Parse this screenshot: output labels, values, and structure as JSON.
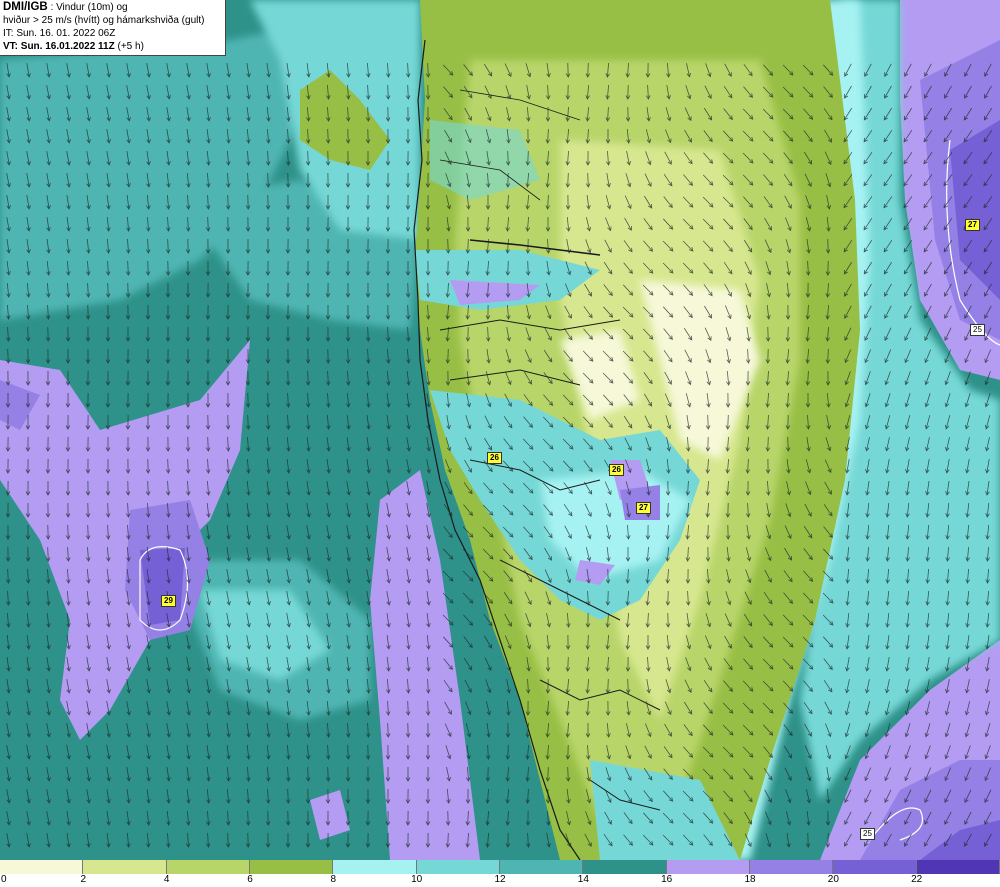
{
  "header": {
    "title_strong": "DMI/IGB",
    "title_rest": " : Vindur (10m) og",
    "line2": "hviður > 25 m/s (hvítt) og hámarkshviða (gult)",
    "line3": "IT: Sun. 16. 01. 2022 06Z",
    "line4_strong": "VT: Sun. 16.01.2022 11Z",
    "line4_rest": " (+5 h)"
  },
  "legend": {
    "colors": [
      "#f6f8d8",
      "#d7e78f",
      "#b8d56a",
      "#98bf45",
      "#a6f2f2",
      "#76d8d6",
      "#4fb5b2",
      "#2e928a",
      "#b49cf2",
      "#9580e6",
      "#7660d6",
      "#5036b4"
    ],
    "ticks": [
      "0",
      "2",
      "4",
      "6",
      "8",
      "10",
      "12",
      "14",
      "16",
      "18",
      "20",
      "22"
    ]
  },
  "gust_labels": [
    "26",
    "26",
    "27",
    "27",
    "29"
  ],
  "hvida_labels": [
    "25",
    "25"
  ],
  "map_colors": {
    "sea_deep": "#2e928a",
    "sea_mid": "#4fb5b2",
    "sea_light": "#76d8d6",
    "cyan": "#a6f2f2",
    "purple": "#b49cf2",
    "purple_mid": "#9580e6",
    "purple_dark": "#7660d6",
    "land_olive": "#98bf45",
    "land_green": "#b8d56a",
    "land_light": "#d7e78f",
    "land_pale": "#f6f8d8",
    "coast": "#1a1a1a",
    "arrow": "#1d2b2b"
  }
}
